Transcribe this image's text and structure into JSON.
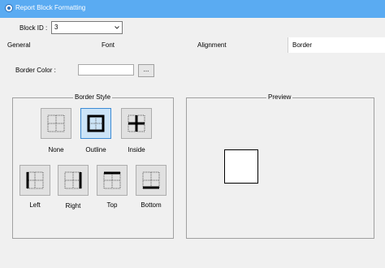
{
  "window": {
    "title": "Report Block Formatting",
    "icon": "app-icon"
  },
  "block_id": {
    "label": "Block ID :",
    "value": "3"
  },
  "tabs": [
    {
      "label": "General"
    },
    {
      "label": "Font"
    },
    {
      "label": "Alignment"
    },
    {
      "label": "Border",
      "active": true
    }
  ],
  "border_color": {
    "label": "Border Color :",
    "value": "",
    "button_label": "..."
  },
  "border_style": {
    "title": "Border Style",
    "options": [
      {
        "label": "None",
        "icon": "border-none-icon"
      },
      {
        "label": "Outline",
        "icon": "border-outline-icon",
        "selected": true
      },
      {
        "label": "Inside",
        "icon": "border-inside-icon"
      },
      {
        "label": "Left",
        "icon": "border-left-icon"
      },
      {
        "label": "Right",
        "icon": "border-right-icon"
      },
      {
        "label": "Top",
        "icon": "border-top-icon"
      },
      {
        "label": "Bottom",
        "icon": "border-bottom-icon"
      }
    ]
  },
  "preview": {
    "title": "Preview"
  },
  "colors": {
    "titlebar": "#5aabf2",
    "selected_button": "#cce4f7",
    "selected_border": "#3d8bd4"
  }
}
